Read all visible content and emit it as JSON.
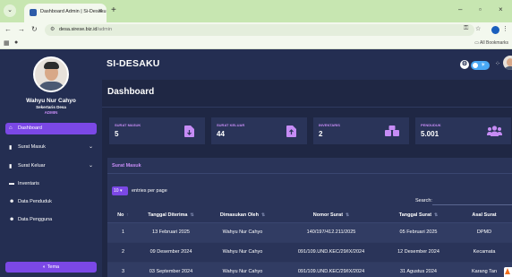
{
  "browser": {
    "tab_title": "Dashboard Admin | Si-Desaku",
    "url_host": "desa.sirese.biz.id",
    "url_path": "/admin",
    "bookmarks_label": "All Bookmarks"
  },
  "sidebar": {
    "user_name": "Wahyu Nur Cahyo",
    "user_role": "Sekertaris Desa",
    "user_badge": "ADMIN",
    "items": [
      {
        "label": "Dashboard",
        "icon": "home-icon",
        "active": true
      },
      {
        "label": "Surat Masuk",
        "icon": "file-icon",
        "has_chevron": true
      },
      {
        "label": "Surat Keluar",
        "icon": "file-icon",
        "has_chevron": true
      },
      {
        "label": "Inventaris",
        "icon": "truck-icon"
      },
      {
        "label": "Data Penduduk",
        "icon": "users-icon"
      },
      {
        "label": "Data Pengguna",
        "icon": "users-icon"
      }
    ],
    "theme_button": "Tema"
  },
  "appbar": {
    "brand": "SI-DESAKU"
  },
  "page": {
    "title": "Dashboard"
  },
  "stats": [
    {
      "label": "SURAT MASUK",
      "value": "5",
      "color": "#c68cf5",
      "icon_color": "#c68cf5"
    },
    {
      "label": "SURAT KELUAR",
      "value": "44",
      "color": "#c68cf5",
      "icon_color": "#c68cf5"
    },
    {
      "label": "INVENTARIS",
      "value": "2",
      "color": "#c68cf5",
      "icon_color": "#c68cf5"
    },
    {
      "label": "PENDUDUK",
      "value": "5.001",
      "color": "#c68cf5",
      "icon_color": "#c68cf5"
    }
  ],
  "panel": {
    "title": "Surat Masuk",
    "page_length": "10",
    "page_length_label": "entries per page",
    "search_label": "Search:",
    "search_value": ""
  },
  "table": {
    "columns": [
      "No",
      "Tanggal Diterima",
      "Dimasukan Oleh",
      "Nomor Surat",
      "Tanggal Surat",
      "Asal Surat"
    ],
    "rows": [
      [
        "1",
        "13 Februari 2025",
        "Wahyu Nur Cahyo",
        "140/197/412.211/2025",
        "05 Februari 2025",
        "DPMD"
      ],
      [
        "2",
        "09 Desember 2024",
        "Wahyu Nur Cahyo",
        "091/109.UND.KEC/29/IX/2024",
        "12 Desember 2024",
        "Kecamata"
      ],
      [
        "3",
        "03 September 2024",
        "Wahyu Nur Cahyo",
        "091/109.UND.KEC/29/IX/2024",
        "31 Agustus 2024",
        "Karang Tan"
      ]
    ]
  },
  "colors": {
    "accent": "#7b48e6",
    "label": "#c68cf5",
    "sidebar_bg": "#242e52",
    "main_bg": "#1f2744",
    "card_bg": "#2a3459"
  }
}
